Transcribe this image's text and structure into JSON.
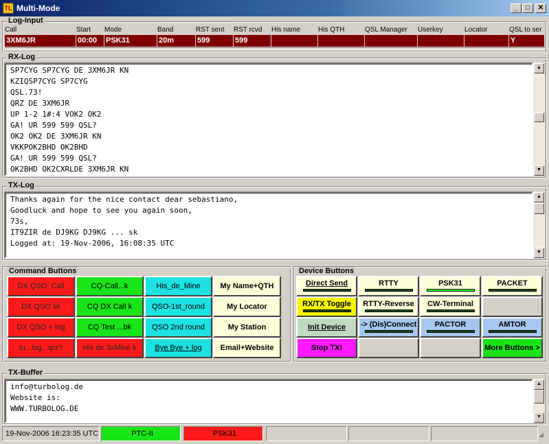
{
  "window": {
    "title": "Multi-Mode",
    "icon_text": "TL",
    "minimize_label": "_",
    "maximize_label": "□",
    "close_label": "✕"
  },
  "log_input": {
    "title": "Log-Input",
    "columns": [
      "Call",
      "Start",
      "Mode",
      "Band",
      "RST sent",
      "RST rcvd",
      "His name",
      "His QTH",
      "QSL Manager",
      "Userkey",
      "Locator",
      "QSL to ser"
    ],
    "values": [
      "3XM6JR",
      "00:00",
      "PSK31",
      "20m",
      "599",
      "599",
      "",
      "",
      "",
      "",
      "",
      "Y"
    ]
  },
  "rx_log": {
    "title": "RX-Log",
    "text": "SP7CYG SP7CYG DE 3XM6JR KN\nKZIQSP7CYG SP7CYG\nQSL.73!\nQRZ DE 3XM6JR\nUP 1-2 1#:4 VOK2 OK2\nGA! UR 599 599 QSL?\nOK2 OK2 DE 3XM6JR KN\nVKKPOK2BHD OK2BHD\nGA! UR 599 599 QSL?\nOK2BHD OK2CXRLDE 3XM6JR KN"
  },
  "tx_log": {
    "title": "TX-Log",
    "text": "Thanks again for the nice contact dear sebastiano,\nGoodluck and hope to see you again soon,\n73s,\nIT9ZIR de DJ9KG DJ9KG ... sk\nLogged at: 19-Nov-2006, 16:08:35 UTC"
  },
  "command_buttons": {
    "title": "Command Buttons",
    "rows": [
      [
        "DX QSO: Call",
        "CQ-Call...k",
        "His_de_Mine",
        "My Name+QTH"
      ],
      [
        "DX QSO sk",
        "CQ DX Call k",
        "QSO-1st_round",
        "My Locator"
      ],
      [
        "DX QSO + log",
        "CQ Test ...bk",
        "QSO 2nd round",
        "My Station"
      ],
      [
        "tu...log...qrz?",
        "His de 3xMine k",
        "Bye Bye + log",
        "Email+Website"
      ]
    ]
  },
  "device_buttons": {
    "title": "Device Buttons",
    "rows": [
      [
        "Direct Send",
        "RTTY",
        "PSK31",
        "PACKET"
      ],
      [
        "RX/TX Toggle",
        "RTTY-Reverse",
        "CW-Terminal",
        ""
      ],
      [
        "Init Device",
        "-> (Dis)Connect",
        "PACTOR",
        "AMTOR"
      ],
      [
        "Stop TX!",
        "",
        "",
        "More Buttons >"
      ]
    ]
  },
  "tx_buffer": {
    "title": "TX-Buffer",
    "text": "info@turbolog.de\nWebsite is:\nWWW.TURBOLOG.DE"
  },
  "status_bar": {
    "datetime": "19-Nov-2006  16:23:35 UTC",
    "device": "PTC-II",
    "mode": "PSK31"
  },
  "colors": {
    "log_row": "#800000",
    "status_device": "#1ae41a",
    "status_mode": "#ff1a1a"
  }
}
